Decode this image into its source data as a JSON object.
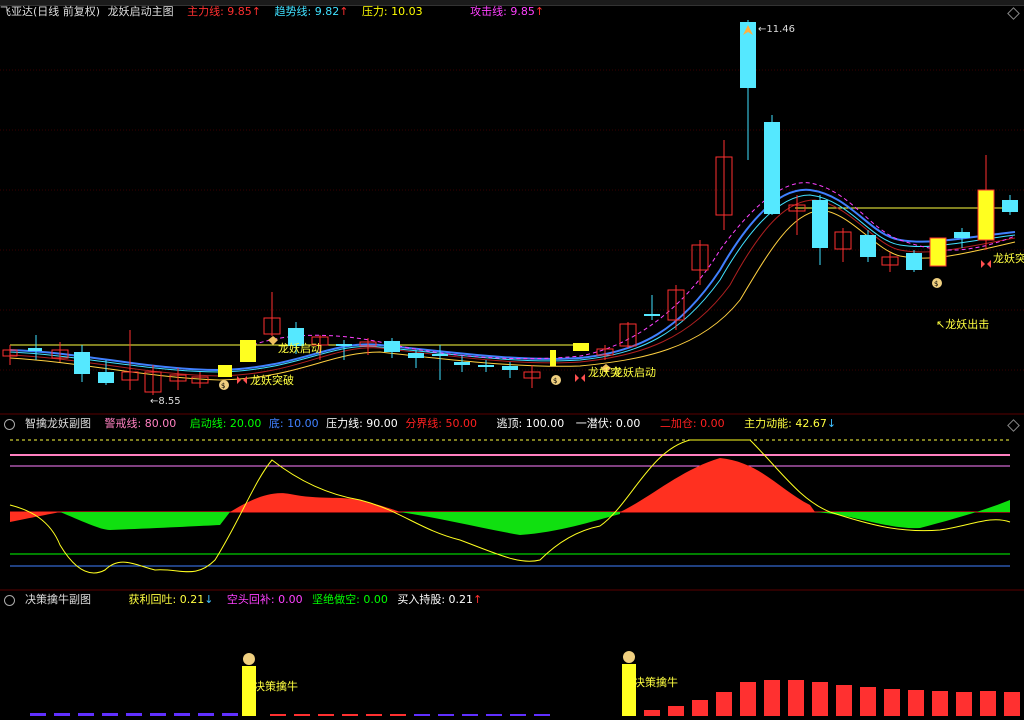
{
  "main_panel": {
    "stock_name": "飞亚达(日线 前复权)",
    "indicator_title": "龙妖启动主图",
    "fields": [
      {
        "label": "主力线: 9.85",
        "arrow": "↑",
        "color": "#ff3030"
      },
      {
        "label": "趋势线: 9.82",
        "arrow": "↑",
        "color": "#40e0ff"
      },
      {
        "label": "压力: 10.03",
        "arrow": "",
        "color": "#ffff00"
      },
      {
        "label": "攻击线: 9.85",
        "arrow": "↑",
        "color": "#ff40ff"
      }
    ],
    "high_label": "11.46",
    "low_label": "8.55",
    "annotations": {
      "breakthrough_1": "龙妖突破",
      "start_1": "龙妖启动",
      "breakthrough_2": "龙妖突",
      "start_2": "龙妖启动",
      "exit": "龙妖出击",
      "breakthrough_3": "龙妖突"
    }
  },
  "sub_panel_1": {
    "title": "智擒龙妖副图",
    "fields": [
      {
        "label": "警戒线: 80.00",
        "color": "#ff80c0"
      },
      {
        "label": "启动线: 20.00",
        "color": "#00ff00"
      },
      {
        "label": "底: 10.00",
        "color": "#4080ff"
      },
      {
        "label": "压力线: 90.00",
        "color": "#ffffff"
      },
      {
        "label": "分界线: 50.00",
        "color": "#ff2020"
      },
      {
        "label": "逃顶: 100.00",
        "color": "#ffffff"
      },
      {
        "label": "一潜伏: 0.00",
        "color": "#ffffff"
      },
      {
        "label": "二加仓: 0.00",
        "color": "#ff2020"
      },
      {
        "label": "主力动能: 42.67",
        "color": "#ffff40",
        "arrow": "↓"
      }
    ]
  },
  "sub_panel_2": {
    "title": "决策擒牛副图",
    "fields": [
      {
        "label": "获利回吐: 0.21",
        "color": "#ffff40",
        "arrow": "↓",
        "arrow_color": "#40c0ff"
      },
      {
        "label": "空头回补: 0.00",
        "color": "#ff40ff",
        "arrow": ""
      },
      {
        "label": "坚绝做空: 0.00",
        "color": "#00ff00",
        "arrow": ""
      },
      {
        "label": "买入持股: 0.21",
        "color": "#ffffff",
        "arrow": "↑",
        "arrow_color": "#ff3030"
      }
    ],
    "signal_label": "决策擒牛"
  }
}
